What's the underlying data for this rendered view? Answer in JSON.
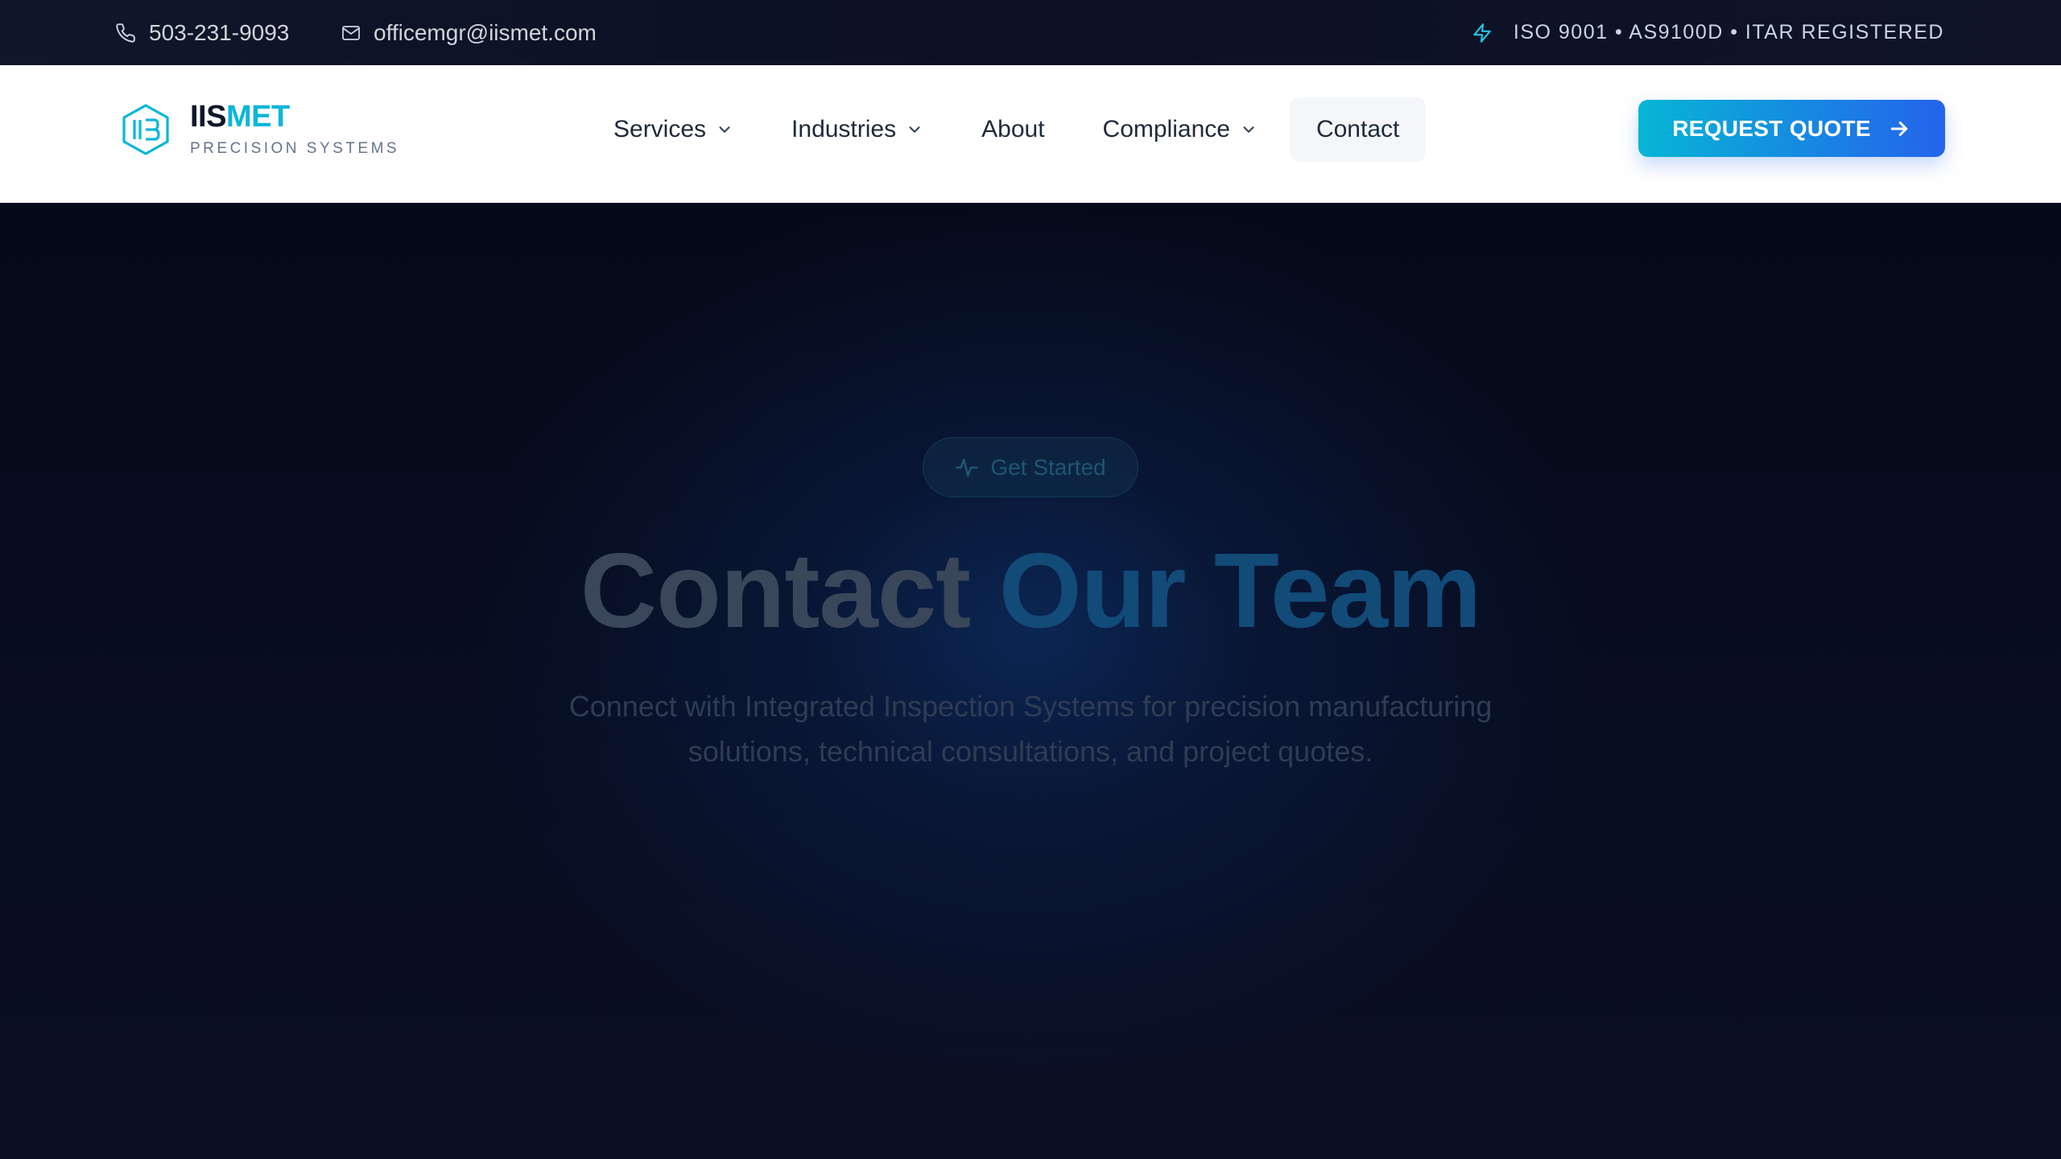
{
  "topbar": {
    "phone": "503-231-9093",
    "email": "officemgr@iismet.com",
    "certifications": "ISO 9001 • AS9100D • ITAR REGISTERED",
    "phone_icon": "phone-icon",
    "email_icon": "mail-icon",
    "cert_icon": "lightning-bolt-icon"
  },
  "brand": {
    "name_primary": "IIS",
    "name_accent": "MET",
    "tagline": "PRECISION SYSTEMS",
    "accent_color": "#0ab6d9"
  },
  "nav": {
    "items": [
      {
        "label": "Services",
        "has_dropdown": true
      },
      {
        "label": "Industries",
        "has_dropdown": true
      },
      {
        "label": "About",
        "has_dropdown": false
      },
      {
        "label": "Compliance",
        "has_dropdown": true
      },
      {
        "label": "Contact",
        "has_dropdown": false,
        "active": true
      }
    ],
    "cta_label": "REQUEST QUOTE",
    "cta_colors": [
      "#06b6d4",
      "#2563eb"
    ]
  },
  "hero": {
    "badge": "Get Started",
    "title_plain": "Contact",
    "title_highlight": "Our Team",
    "subtitle_line1": "Connect with Integrated Inspection Systems for precision manufacturing",
    "subtitle_line2": "solutions, technical consultations, and project quotes."
  }
}
